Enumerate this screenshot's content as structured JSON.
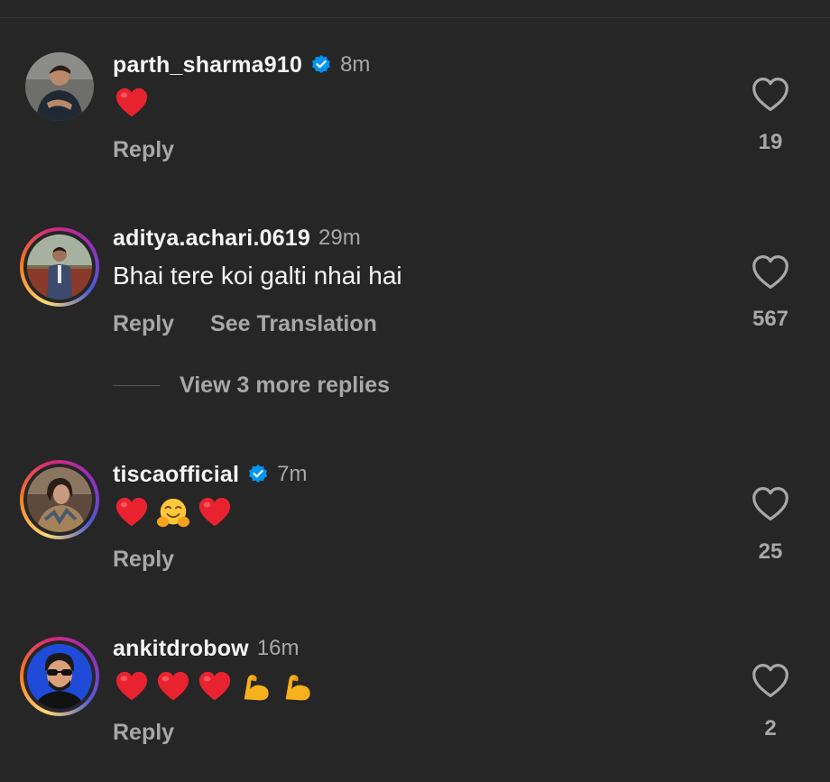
{
  "comments": [
    {
      "username": "parth_sharma910",
      "verified": true,
      "time": "8m",
      "emojis": [
        "red-heart"
      ],
      "actions": [
        "Reply"
      ],
      "likes": "19"
    },
    {
      "username": "aditya.achari.0619",
      "verified": false,
      "time": "29m",
      "text": "Bhai tere koi galti nhai hai",
      "actions": [
        "Reply",
        "See Translation"
      ],
      "likes": "567",
      "view_replies": "View 3 more replies"
    },
    {
      "username": "tiscaofficial",
      "verified": true,
      "time": "7m",
      "emojis": [
        "red-heart",
        "hugging-face",
        "red-heart"
      ],
      "actions": [
        "Reply"
      ],
      "likes": "25"
    },
    {
      "username": "ankitdrobow",
      "verified": false,
      "time": "16m",
      "emojis": [
        "red-heart",
        "red-heart",
        "red-heart",
        "flexed-biceps",
        "flexed-biceps"
      ],
      "actions": [
        "Reply"
      ],
      "likes": "2"
    }
  ],
  "colors": {
    "background": "#262626",
    "primary_text": "#f5f5f5",
    "secondary_text": "#a8a8a8",
    "verified_badge": "#0095f6",
    "heart_emoji": "#e8232f"
  }
}
